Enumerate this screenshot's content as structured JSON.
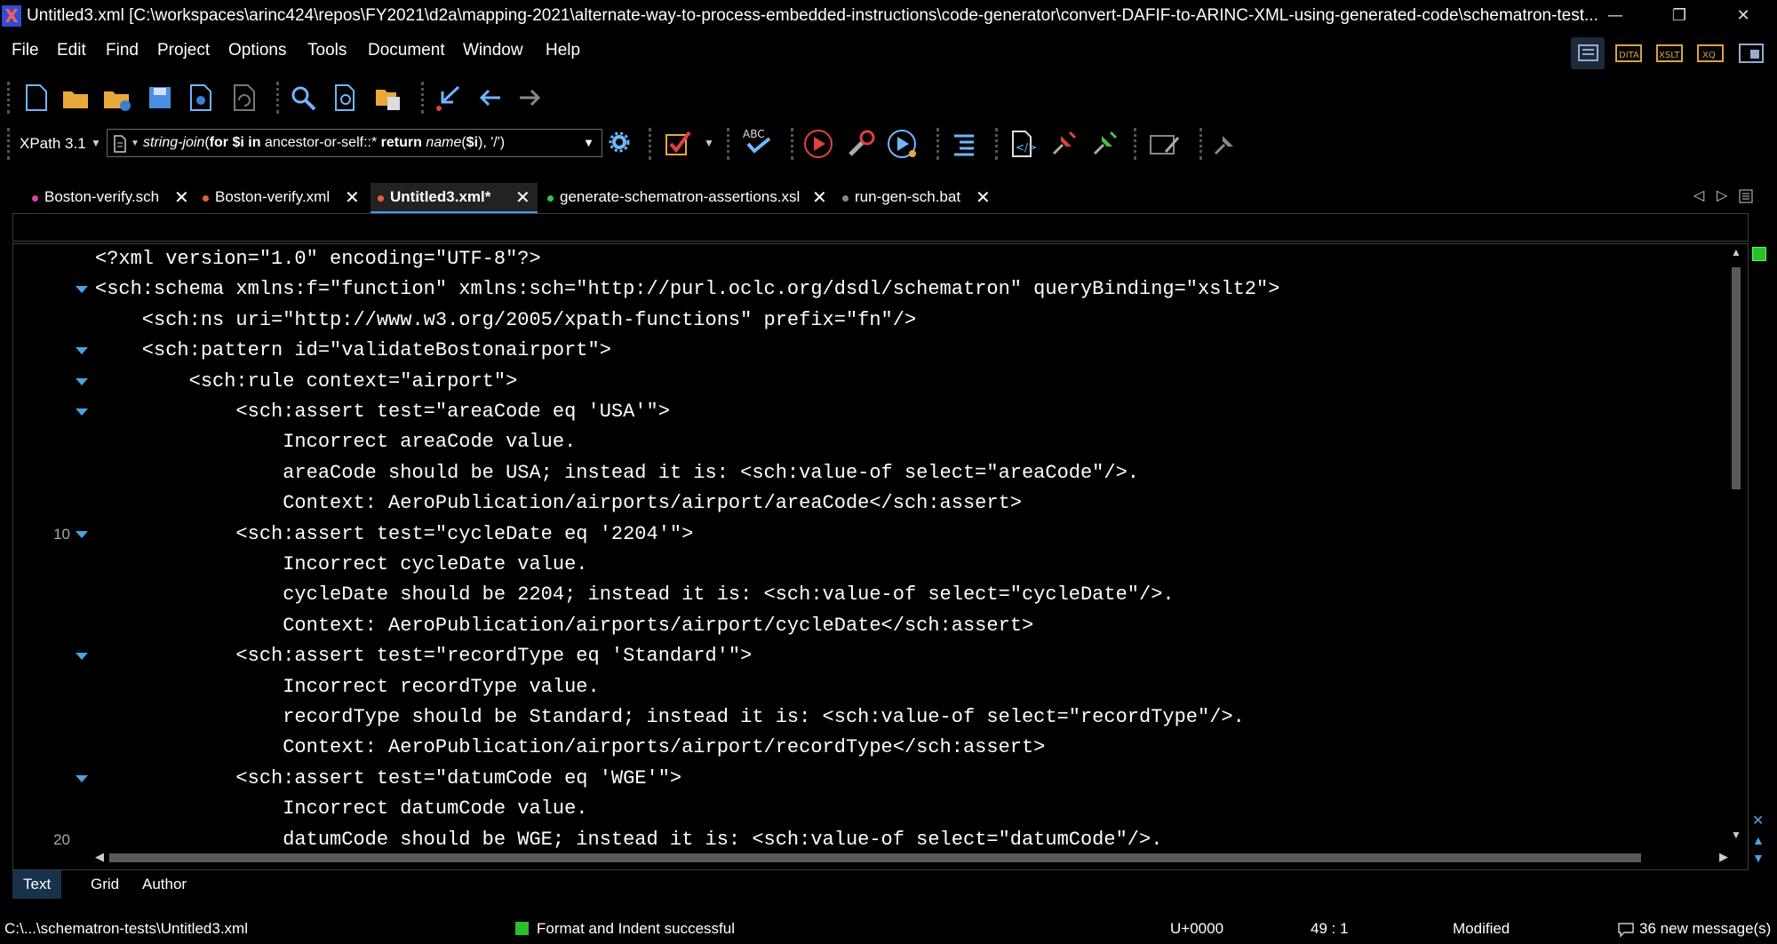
{
  "window": {
    "title": "Untitled3.xml [C:\\workspaces\\arinc424\\repos\\FY2021\\d2a\\mapping-2021\\alternate-way-to-process-embedded-instructions\\code-generator\\convert-DAFIF-to-ARINC-XML-using-generated-code\\schematron-test...",
    "minimize": "—",
    "restore": "❐",
    "close": "✕"
  },
  "menu": [
    "File",
    "Edit",
    "Find",
    "Project",
    "Options",
    "Tools",
    "Document",
    "Window",
    "Help"
  ],
  "perspectives": [
    "Editor",
    "DITA",
    "XSLT",
    "XQuery",
    "Database"
  ],
  "toolbar1_icons": [
    "new-file",
    "open-folder",
    "open-url",
    "save",
    "save-to-url",
    "reload",
    "find",
    "find-in-files",
    "open-project",
    "go-to-last-modification",
    "back",
    "forward"
  ],
  "xpath": {
    "version": "XPath 3.1",
    "expression_parts": [
      {
        "t": "string-join",
        "style": "italic"
      },
      {
        "t": "(",
        "style": "plain"
      },
      {
        "t": "for $i in ",
        "style": "bold"
      },
      {
        "t": "ancestor-or-self::* ",
        "style": "plain"
      },
      {
        "t": "return ",
        "style": "bold"
      },
      {
        "t": "name",
        "style": "italic"
      },
      {
        "t": "(",
        "style": "plain"
      },
      {
        "t": "$i",
        "style": "bold"
      },
      {
        "t": "), '/')",
        "style": "plain"
      }
    ]
  },
  "toolbar2_icons": [
    "run-xpath",
    "validate",
    "validate-dropdown",
    "check-spelling",
    "apply-transformation",
    "configure-transformation",
    "debug-scenario",
    "format-indent",
    "toggle-comment",
    "add-bookmark",
    "next-bookmark",
    "edit-attributes",
    "pin"
  ],
  "tabs": [
    {
      "label": "Boston-verify.sch",
      "dot": "#e040a0",
      "active": false
    },
    {
      "label": "Boston-verify.xml",
      "dot": "#e86040",
      "active": false
    },
    {
      "label": "Untitled3.xml*",
      "dot": "#e86040",
      "active": true
    },
    {
      "label": "generate-schematron-assertions.xsl",
      "dot": "#40c040",
      "active": false
    },
    {
      "label": "run-gen-sch.bat",
      "dot": "#888888",
      "active": false
    }
  ],
  "editor": {
    "lines": [
      {
        "n": "",
        "fold": false,
        "text": "<?xml version=\"1.0\" encoding=\"UTF-8\"?>"
      },
      {
        "n": "",
        "fold": true,
        "text": "<sch:schema xmlns:f=\"function\" xmlns:sch=\"http://purl.oclc.org/dsdl/schematron\" queryBinding=\"xslt2\">"
      },
      {
        "n": "",
        "fold": false,
        "text": "    <sch:ns uri=\"http://www.w3.org/2005/xpath-functions\" prefix=\"fn\"/>"
      },
      {
        "n": "",
        "fold": true,
        "text": "    <sch:pattern id=\"validateBostonairport\">"
      },
      {
        "n": "",
        "fold": true,
        "text": "        <sch:rule context=\"airport\">"
      },
      {
        "n": "",
        "fold": true,
        "text": "            <sch:assert test=\"areaCode eq 'USA'\">"
      },
      {
        "n": "",
        "fold": false,
        "text": "                Incorrect areaCode value."
      },
      {
        "n": "",
        "fold": false,
        "text": "                areaCode should be USA; instead it is: <sch:value-of select=\"areaCode\"/>."
      },
      {
        "n": "",
        "fold": false,
        "text": "                Context: AeroPublication/airports/airport/areaCode</sch:assert>"
      },
      {
        "n": "10",
        "fold": true,
        "text": "            <sch:assert test=\"cycleDate eq '2204'\">"
      },
      {
        "n": "",
        "fold": false,
        "text": "                Incorrect cycleDate value."
      },
      {
        "n": "",
        "fold": false,
        "text": "                cycleDate should be 2204; instead it is: <sch:value-of select=\"cycleDate\"/>."
      },
      {
        "n": "",
        "fold": false,
        "text": "                Context: AeroPublication/airports/airport/cycleDate</sch:assert>"
      },
      {
        "n": "",
        "fold": true,
        "text": "            <sch:assert test=\"recordType eq 'Standard'\">"
      },
      {
        "n": "",
        "fold": false,
        "text": "                Incorrect recordType value."
      },
      {
        "n": "",
        "fold": false,
        "text": "                recordType should be Standard; instead it is: <sch:value-of select=\"recordType\"/>."
      },
      {
        "n": "",
        "fold": false,
        "text": "                Context: AeroPublication/airports/airport/recordType</sch:assert>"
      },
      {
        "n": "",
        "fold": true,
        "text": "            <sch:assert test=\"datumCode eq 'WGE'\">"
      },
      {
        "n": "",
        "fold": false,
        "text": "                Incorrect datumCode value."
      },
      {
        "n": "20",
        "fold": false,
        "text": "                datumCode should be WGE; instead it is: <sch:value-of select=\"datumCode\"/>."
      }
    ]
  },
  "modes": [
    {
      "label": "Text",
      "active": true
    },
    {
      "label": "Grid",
      "active": false
    },
    {
      "label": "Author",
      "active": false
    }
  ],
  "status": {
    "path": "C:\\...\\schematron-tests\\Untitled3.xml",
    "message": "Format and Indent successful",
    "unicode": "U+0000",
    "position": "49 : 1",
    "modified": "Modified",
    "messages": "36 new message(s)"
  }
}
